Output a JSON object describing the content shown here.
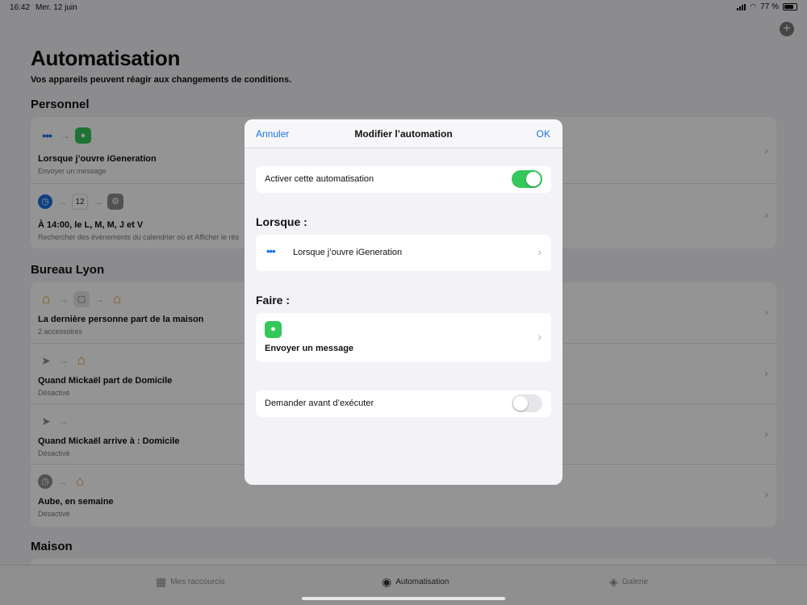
{
  "status_bar": {
    "time": "16:42",
    "date": "Mer. 12 juin",
    "battery": "77 %"
  },
  "page": {
    "title": "Automatisation",
    "subtitle": "Vos appareils peuvent réagir aux changements de conditions."
  },
  "sections": {
    "personnel": {
      "title": "Personnel",
      "rows": [
        {
          "title": "Lorsque j’ouvre iGeneration",
          "subtitle": "Envoyer un message"
        },
        {
          "title": "À 14:00, le L, M, M, J et V",
          "subtitle": "Rechercher des événements du calendrier où et Afficher le rés"
        }
      ]
    },
    "bureau": {
      "title": "Bureau Lyon",
      "rows": [
        {
          "title": "La dernière personne part de la maison",
          "subtitle": "2 accessoires"
        },
        {
          "title": "Quand Mickaël part de Domicile",
          "subtitle": "Désactivé"
        },
        {
          "title": "Quand Mickaël arrive à : Domicile",
          "subtitle": "Désactivé"
        },
        {
          "title": "Aube, en semaine",
          "subtitle": "Désactivé"
        }
      ]
    },
    "maison": {
      "title": "Maison"
    }
  },
  "calendar_day": "12",
  "tabs": [
    {
      "label": "Mes raccourcis",
      "icon": "grid-icon"
    },
    {
      "label": "Automatisation",
      "icon": "check-circle-icon"
    },
    {
      "label": "Galerie",
      "icon": "layers-icon"
    }
  ],
  "modal": {
    "cancel": "Annuler",
    "title": "Modifier l’automation",
    "ok": "OK",
    "enable_label": "Activer cette automatisation",
    "enable_on": true,
    "when_heading": "Lorsque :",
    "trigger_label": "Lorsque j’ouvre iGeneration",
    "do_heading": "Faire :",
    "action_label": "Envoyer un message",
    "ask_label": "Demander avant d’exécuter",
    "ask_on": false
  },
  "colors": {
    "accent": "#1a73e8",
    "toggle_on": "#34c759",
    "home_orange": "#e8902a"
  }
}
